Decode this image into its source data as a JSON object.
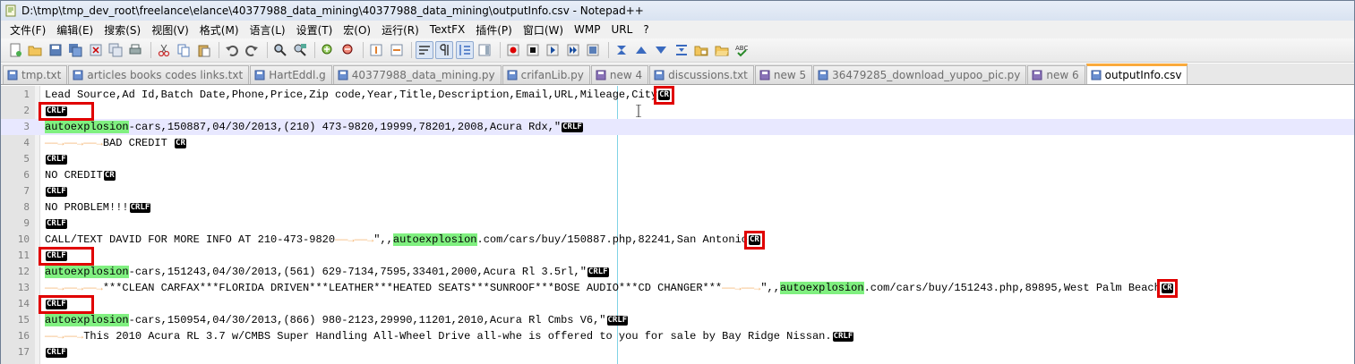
{
  "window": {
    "title": "D:\\tmp\\tmp_dev_root\\freelance\\elance\\40377988_data_mining\\40377988_data_mining\\outputInfo.csv - Notepad++"
  },
  "menu": [
    {
      "label": "文件(F)"
    },
    {
      "label": "编辑(E)"
    },
    {
      "label": "搜索(S)"
    },
    {
      "label": "视图(V)"
    },
    {
      "label": "格式(M)"
    },
    {
      "label": "语言(L)"
    },
    {
      "label": "设置(T)"
    },
    {
      "label": "宏(O)"
    },
    {
      "label": "运行(R)"
    },
    {
      "label": "TextFX"
    },
    {
      "label": "插件(P)"
    },
    {
      "label": "窗口(W)"
    },
    {
      "label": "WMP"
    },
    {
      "label": "URL"
    },
    {
      "label": "?"
    }
  ],
  "toolbar_icons": [
    "new-file-icon",
    "open-file-icon",
    "save-icon",
    "save-all-icon",
    "close-icon",
    "close-all-icon",
    "print-icon",
    "cut-icon",
    "copy-icon",
    "paste-icon",
    "undo-icon",
    "redo-icon",
    "find-icon",
    "replace-icon",
    "zoom-in-icon",
    "zoom-out-icon",
    "sync-v-icon",
    "sync-h-icon",
    "word-wrap-icon",
    "show-all-chars-icon",
    "indent-guide-icon",
    "doc-map-icon",
    "record-macro-icon",
    "stop-record-icon",
    "play-macro-icon",
    "run-macro-multiple-icon",
    "save-macro-icon",
    "sort-icon",
    "move-up-icon",
    "move-down-icon",
    "collapse-icon",
    "folder-icon",
    "open-folder-icon",
    "spellcheck-icon"
  ],
  "tabs": [
    {
      "label": "tmp.txt",
      "type": "saved"
    },
    {
      "label": "articles books codes links.txt",
      "type": "saved"
    },
    {
      "label": "HartEddl.g",
      "type": "saved"
    },
    {
      "label": "40377988_data_mining.py",
      "type": "saved"
    },
    {
      "label": "crifanLib.py",
      "type": "saved"
    },
    {
      "label": "new 4",
      "type": "unsaved"
    },
    {
      "label": "discussions.txt",
      "type": "saved"
    },
    {
      "label": "new 5",
      "type": "unsaved"
    },
    {
      "label": "36479285_download_yupoo_pic.py",
      "type": "saved"
    },
    {
      "label": "new 6",
      "type": "unsaved"
    },
    {
      "label": "outputInfo.csv",
      "type": "saved",
      "active": true
    }
  ],
  "editor": {
    "current_line": 3,
    "lines": [
      {
        "num": "1",
        "segments": [
          {
            "t": "Lead Source,Ad Id,Batch Date,Phone,Price,Zip code,Year,Title,Description,Email,URL,Mileage,City"
          }
        ],
        "eol": "CR"
      },
      {
        "num": "2",
        "segments": [],
        "eol": "CRLF"
      },
      {
        "num": "3",
        "segments": [
          {
            "t": "autoexplosion",
            "hl": true
          },
          {
            "t": "-cars,150887,04/30/2013,(210) 473-9820,19999,78201,2008,Acura Rdx,\""
          }
        ],
        "eol": "CRLF"
      },
      {
        "num": "4",
        "segments": [
          {
            "t": "——→——→——→",
            "arrow": true
          },
          {
            "t": "BAD CREDIT "
          }
        ],
        "eol": "CR"
      },
      {
        "num": "5",
        "segments": [],
        "eol": "CRLF"
      },
      {
        "num": "6",
        "segments": [
          {
            "t": "NO CREDIT"
          }
        ],
        "eol": "CR"
      },
      {
        "num": "7",
        "segments": [],
        "eol": "CRLF"
      },
      {
        "num": "8",
        "segments": [
          {
            "t": "NO PROBLEM!!!"
          }
        ],
        "eol": "CRLF"
      },
      {
        "num": "9",
        "segments": [],
        "eol": "CRLF"
      },
      {
        "num": "10",
        "segments": [
          {
            "t": "CALL/TEXT DAVID FOR MORE INFO AT 210-473-9820"
          },
          {
            "t": "——→——→",
            "arrow": true
          },
          {
            "t": "\",,"
          },
          {
            "t": "autoexplosion",
            "hl": true
          },
          {
            "t": ".com/cars/buy/150887.php,82241,San Antonio"
          }
        ],
        "eol": "CR"
      },
      {
        "num": "11",
        "segments": [],
        "eol": "CRLF"
      },
      {
        "num": "12",
        "segments": [
          {
            "t": "autoexplosion",
            "hl": true
          },
          {
            "t": "-cars,151243,04/30/2013,(561) 629-7134,7595,33401,2000,Acura Rl 3.5rl,\""
          }
        ],
        "eol": "CRLF"
      },
      {
        "num": "13",
        "segments": [
          {
            "t": "——→——→——→",
            "arrow": true
          },
          {
            "t": "***CLEAN CARFAX***FLORIDA DRIVEN***LEATHER***HEATED SEATS***SUNROOF***BOSE AUDIO***CD CHANGER***"
          },
          {
            "t": "——→——→",
            "arrow": true
          },
          {
            "t": "\",,"
          },
          {
            "t": "autoexplosion",
            "hl": true
          },
          {
            "t": ".com/cars/buy/151243.php,89895,West Palm Beach"
          }
        ],
        "eol": "CR"
      },
      {
        "num": "14",
        "segments": [],
        "eol": "CRLF"
      },
      {
        "num": "15",
        "segments": [
          {
            "t": "autoexplosion",
            "hl": true
          },
          {
            "t": "-cars,150954,04/30/2013,(866) 980-2123,29990,11201,2010,Acura Rl Cmbs V6,\""
          }
        ],
        "eol": "CRLF"
      },
      {
        "num": "16",
        "segments": [
          {
            "t": "——→——→",
            "arrow": true
          },
          {
            "t": "This 2010 Acura RL 3.7 w/CMBS Super Handling All-Wheel Drive all-whe is offered to you for sale by Bay Ridge Nissan."
          }
        ],
        "eol": "CRLF"
      },
      {
        "num": "17",
        "segments": [],
        "eol": "CRLF"
      }
    ]
  },
  "colors": {
    "highlight": "#80f080",
    "annotation_box": "#e00000",
    "active_tab_accent": "#faaa3c"
  }
}
